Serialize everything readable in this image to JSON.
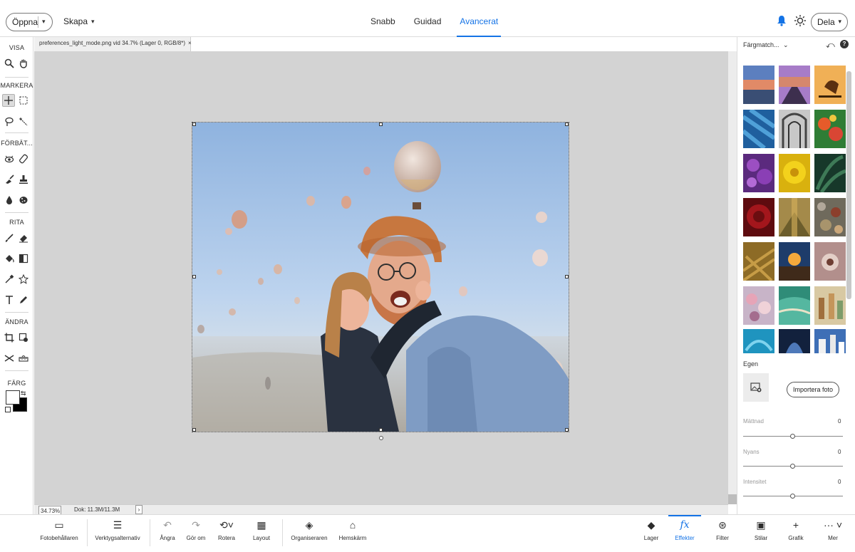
{
  "topbar": {
    "open_label": "Öppna",
    "create_label": "Skapa",
    "modes": [
      "Snabb",
      "Guidad",
      "Avancerat"
    ],
    "active_mode": "Avancerat",
    "share_label": "Dela",
    "accent": "#1473e6"
  },
  "toolbar": {
    "sections": [
      "VISA",
      "MARKERA",
      "FÖRBÄT...",
      "RITA",
      "ÄNDRA",
      "FÄRG"
    ],
    "tools": [
      {
        "name": "zoom-tool-icon",
        "glyph": "⚲"
      },
      {
        "name": "hand-tool-icon",
        "glyph": "✋"
      },
      {
        "name": "move-tool-icon",
        "glyph": "✛"
      },
      {
        "name": "marquee-tool-icon",
        "glyph": "⬚"
      },
      {
        "name": "lasso-tool-icon",
        "glyph": "ℓ"
      },
      {
        "name": "magic-wand-tool-icon",
        "glyph": "✧"
      },
      {
        "name": "red-eye-tool-icon",
        "glyph": "◉"
      },
      {
        "name": "healing-brush-tool-icon",
        "glyph": "✎"
      },
      {
        "name": "smart-brush-tool-icon",
        "glyph": "✐"
      },
      {
        "name": "clone-stamp-tool-icon",
        "glyph": "⊥"
      },
      {
        "name": "blur-tool-icon",
        "glyph": "💧"
      },
      {
        "name": "sponge-tool-icon",
        "glyph": "⬣"
      },
      {
        "name": "brush-tool-icon",
        "glyph": "✏"
      },
      {
        "name": "eraser-tool-icon",
        "glyph": "◆"
      },
      {
        "name": "paint-bucket-tool-icon",
        "glyph": "⬙"
      },
      {
        "name": "gradient-tool-icon",
        "glyph": "◧"
      },
      {
        "name": "eyedropper-tool-icon",
        "glyph": "⟋"
      },
      {
        "name": "custom-shape-tool-icon",
        "glyph": "☆"
      },
      {
        "name": "type-tool-icon",
        "glyph": "T"
      },
      {
        "name": "pencil-tool-icon",
        "glyph": "✒"
      },
      {
        "name": "crop-tool-icon",
        "glyph": "⌗"
      },
      {
        "name": "recompose-tool-icon",
        "glyph": "⧉"
      },
      {
        "name": "content-aware-move-tool-icon",
        "glyph": "✂"
      },
      {
        "name": "straighten-tool-icon",
        "glyph": "⏥"
      }
    ]
  },
  "document": {
    "tab_title": "preferences_light_mode.png vid 34.7% (Lager 0, RGB/8*)",
    "close": "×"
  },
  "statusbar": {
    "zoom": "34.73%",
    "doc_info": "Dok: 11.3M/11.3M",
    "arrow": "›"
  },
  "rightpanel": {
    "title": "Färgmatch...",
    "egen_label": "Egen",
    "import_label": "Importera foto",
    "sliders": [
      {
        "label": "Mättnad",
        "value": "0",
        "position": 0.5
      },
      {
        "label": "Nyans",
        "value": "0",
        "position": 0.5
      },
      {
        "label": "Intensitet",
        "value": "0",
        "position": 0.5
      }
    ]
  },
  "bottombar": {
    "items": [
      {
        "name": "photo-bin-button",
        "icon": "folder-icon",
        "glyph": "▭",
        "label": "Fotobehållaren"
      },
      {
        "name": "tool-options-button",
        "icon": "tool-options-icon",
        "glyph": "☰",
        "label": "Verktygsalternativ"
      },
      {
        "name": "undo-button",
        "icon": "undo-icon",
        "glyph": "↶",
        "label": "Ångra"
      },
      {
        "name": "redo-button",
        "icon": "redo-icon",
        "glyph": "↷",
        "label": "Gör om"
      },
      {
        "name": "rotate-button",
        "icon": "rotate-icon",
        "glyph": "⟲",
        "label": "Rotera"
      },
      {
        "name": "layout-button",
        "icon": "layout-icon",
        "glyph": "▦",
        "label": "Layout"
      },
      {
        "name": "organizer-button",
        "icon": "organizer-icon",
        "glyph": "◈",
        "label": "Organiseraren"
      },
      {
        "name": "home-button",
        "icon": "home-icon",
        "glyph": "⌂",
        "label": "Hemskärm"
      },
      {
        "name": "layers-button",
        "icon": "layers-icon",
        "glyph": "◆",
        "label": "Lager"
      },
      {
        "name": "effects-button",
        "icon": "fx-icon",
        "glyph": "fx",
        "label": "Effekter"
      },
      {
        "name": "filter-button",
        "icon": "filter-icon",
        "glyph": "⊛",
        "label": "Filter"
      },
      {
        "name": "styles-button",
        "icon": "styles-icon",
        "glyph": "▣",
        "label": "Stilar"
      },
      {
        "name": "graphics-button",
        "icon": "plus-icon",
        "glyph": "+",
        "label": "Grafik"
      },
      {
        "name": "more-button",
        "icon": "more-icon",
        "glyph": "···",
        "label": "Mer"
      }
    ],
    "active": "Effekter"
  }
}
